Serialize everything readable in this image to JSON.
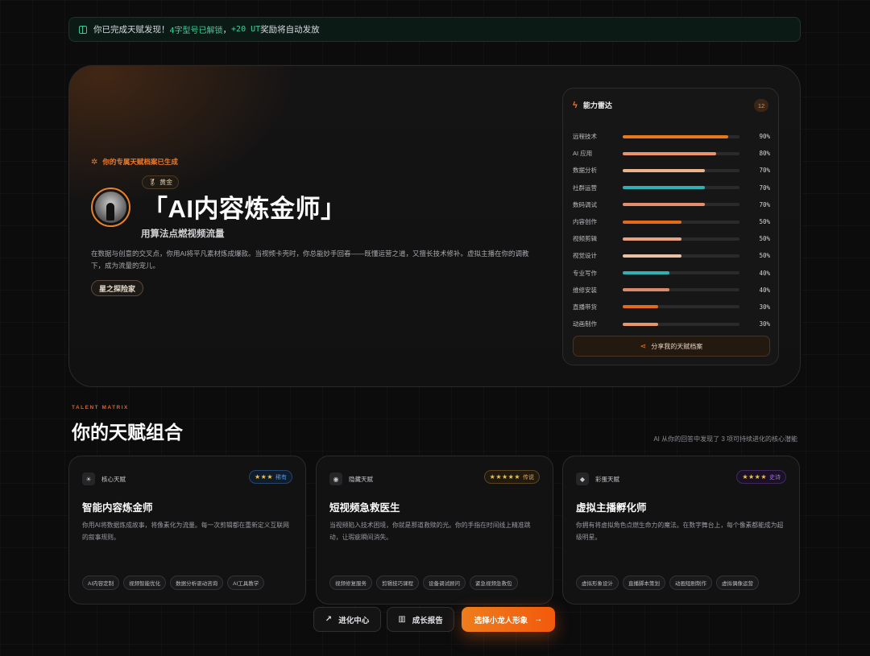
{
  "notice": {
    "prefix": "你已完成天赋发现！",
    "highlight1": "4字型号已解锁",
    "mid": "，",
    "highlight2": "+20 UT",
    "suffix": "奖励将自动发放"
  },
  "hero": {
    "tag": "你的专属天赋档案已生成",
    "badge": "黄金",
    "title": "「AI内容炼金师」",
    "subtitle": "用算法点燃视频流量",
    "description": "在数据与创意的交叉点，你用AI将平凡素材炼成爆款。当视频卡壳时，你总能妙手回春——既懂运营之道，又擅长技术修补。虚拟主播在你的调教下，成为流量的宠儿。",
    "explorer_label": "星之探险家"
  },
  "radar": {
    "title": "能力雷达",
    "count": "12",
    "share_label": "分享我的天赋档案",
    "skills": [
      {
        "name": "远程技术",
        "value": 90,
        "label": "90%",
        "color": "#e8781c"
      },
      {
        "name": "AI 应用",
        "value": 80,
        "label": "80%",
        "color": "#e8956a"
      },
      {
        "name": "数据分析",
        "value": 70,
        "label": "70%",
        "color": "#e8b48e"
      },
      {
        "name": "社群运营",
        "value": 70,
        "label": "70%",
        "color": "#2fb1b4"
      },
      {
        "name": "数码调试",
        "value": 70,
        "label": "70%",
        "color": "#e38e6e"
      },
      {
        "name": "内容创作",
        "value": 50,
        "label": "50%",
        "color": "#e26a1a"
      },
      {
        "name": "视频剪辑",
        "value": 50,
        "label": "50%",
        "color": "#e8a37e"
      },
      {
        "name": "视觉设计",
        "value": 50,
        "label": "50%",
        "color": "#e8c0a6"
      },
      {
        "name": "专业写作",
        "value": 40,
        "label": "40%",
        "color": "#2fb1b4"
      },
      {
        "name": "维修安装",
        "value": 40,
        "label": "40%",
        "color": "#d98a6e"
      },
      {
        "name": "直播带货",
        "value": 30,
        "label": "30%",
        "color": "#e26a1a"
      },
      {
        "name": "动画制作",
        "value": 30,
        "label": "30%",
        "color": "#e8956a"
      }
    ]
  },
  "matrix": {
    "eyebrow": "TALENT MATRIX",
    "title": "你的天赋组合",
    "note": "AI 从你的回答中发现了 3 项可持续进化的核心潜能",
    "cards": [
      {
        "kind": "核心天赋",
        "kind_icon": "☀",
        "stars": "★★★",
        "rarity": "稀有",
        "rarity_color": "#4a9ae8",
        "rarity_border": "#26456a",
        "rarity_bg": "#111c2a",
        "title": "智能内容炼金师",
        "desc": "你用AI将数据炼成故事，将像素化为流量。每一次剪辑都在重新定义互联网的叙事规则。",
        "tags": [
          "AI内容定制",
          "视频智能优化",
          "数据分析驱动咨询",
          "AI工具教学"
        ]
      },
      {
        "kind": "隐藏天赋",
        "kind_icon": "◉",
        "stars": "★★★★★",
        "rarity": "传说",
        "rarity_color": "#e0a84a",
        "rarity_border": "#5a4420",
        "rarity_bg": "#211a10",
        "title": "短视频急救医生",
        "desc": "当视频陷入技术困境，你就是那道救赎的光。你的手指在时间线上精准跳动，让瑕疵瞬间消失。",
        "tags": [
          "视频修复服务",
          "剪辑技巧课程",
          "设备调试顾问",
          "紧急视频急救包"
        ]
      },
      {
        "kind": "彩蛋天赋",
        "kind_icon": "◆",
        "stars": "★★★★",
        "rarity": "史诗",
        "rarity_color": "#a46ae0",
        "rarity_border": "#42285e",
        "rarity_bg": "#1a1224",
        "title": "虚拟主播孵化师",
        "desc": "你拥有将虚拟角色点燃生命力的魔法。在数字舞台上，每个像素都能成为超级明星。",
        "tags": [
          "虚拟形象设计",
          "直播脚本策划",
          "动画短剧制作",
          "虚拟偶像运营"
        ]
      }
    ]
  },
  "actions": {
    "evolve_label": "进化中心",
    "report_label": "成长报告",
    "choose_label": "选择小龙人形象"
  }
}
